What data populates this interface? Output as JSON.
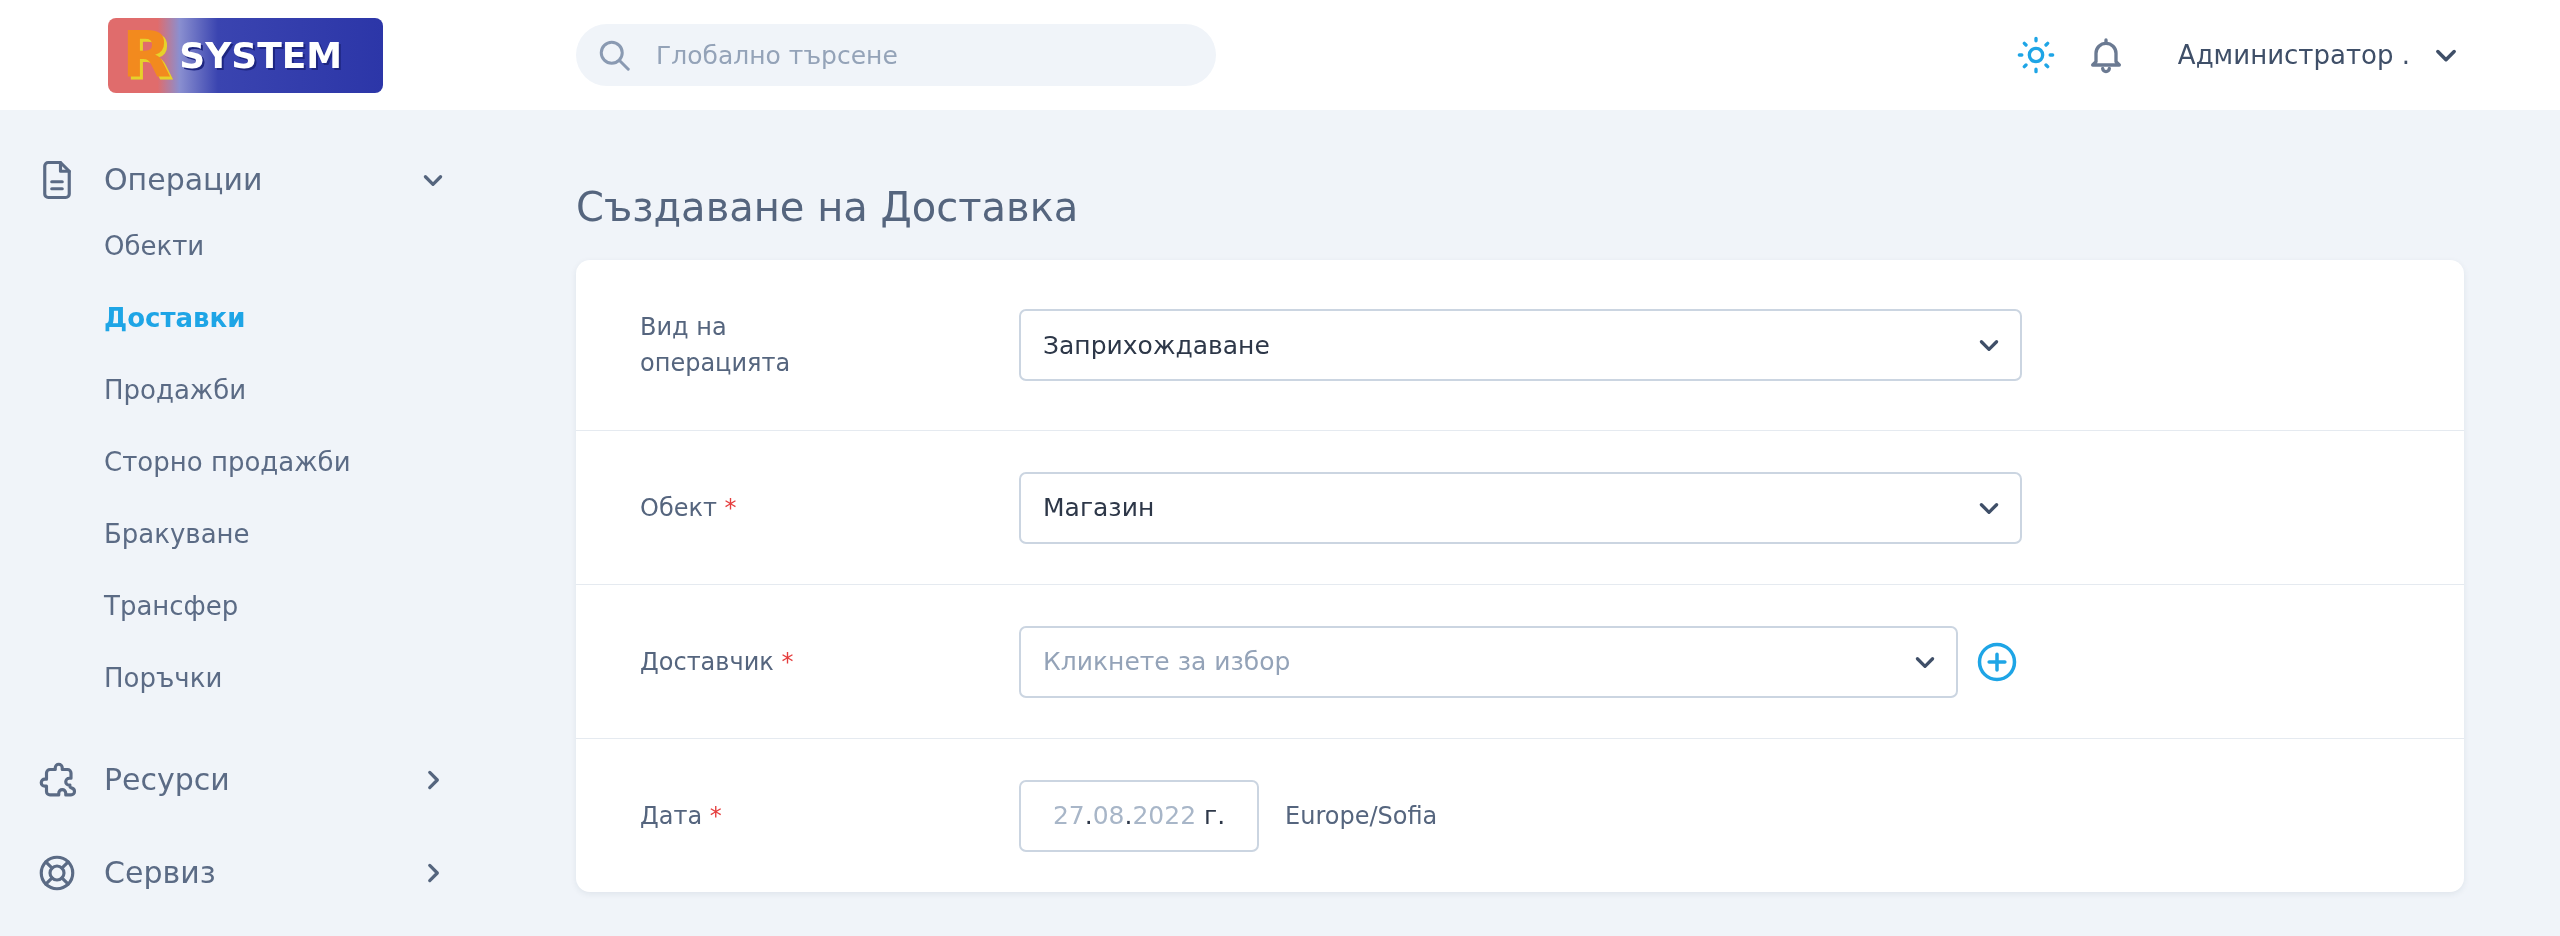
{
  "header": {
    "logo": {
      "letter": "R",
      "text": "SYSTEM"
    },
    "search": {
      "placeholder": "Глобално търсене"
    },
    "theme_light": true,
    "user": {
      "name": "Администратор ."
    }
  },
  "sidebar": {
    "groups": [
      {
        "label": "Операции",
        "expanded": true,
        "children": [
          {
            "label": "Обекти",
            "selected": false
          },
          {
            "label": "Доставки",
            "selected": true
          },
          {
            "label": "Продажби",
            "selected": false
          },
          {
            "label": "Сторно продажби",
            "selected": false
          },
          {
            "label": "Бракуване",
            "selected": false
          },
          {
            "label": "Трансфер",
            "selected": false
          },
          {
            "label": "Поръчки",
            "selected": false
          }
        ]
      },
      {
        "label": "Ресурси",
        "expanded": false
      },
      {
        "label": "Сервиз",
        "expanded": false
      }
    ]
  },
  "page": {
    "title": "Създаване на Доставка"
  },
  "form": {
    "rows": [
      {
        "kind": "select",
        "label": "Вид на операцията",
        "value": "Заприхождаване"
      },
      {
        "kind": "select",
        "label": "Обект",
        "required_mark": "*",
        "value": "Магазин"
      },
      {
        "kind": "select",
        "label": "Доставчик",
        "required_mark": "*",
        "placeholder": "Кликнете за избор",
        "add_button": true
      },
      {
        "kind": "date",
        "label": "Дата",
        "required_mark": "*",
        "parts": [
          {
            "text": "27",
            "kind": "placeholder"
          },
          {
            "text": ".",
            "kind": "literal"
          },
          {
            "text": "08",
            "kind": "placeholder"
          },
          {
            "text": ".",
            "kind": "literal"
          },
          {
            "text": "2022",
            "kind": "placeholder"
          },
          {
            "text": " г.",
            "kind": "literal"
          }
        ],
        "timezone": "Europe/Sofia"
      }
    ]
  }
}
